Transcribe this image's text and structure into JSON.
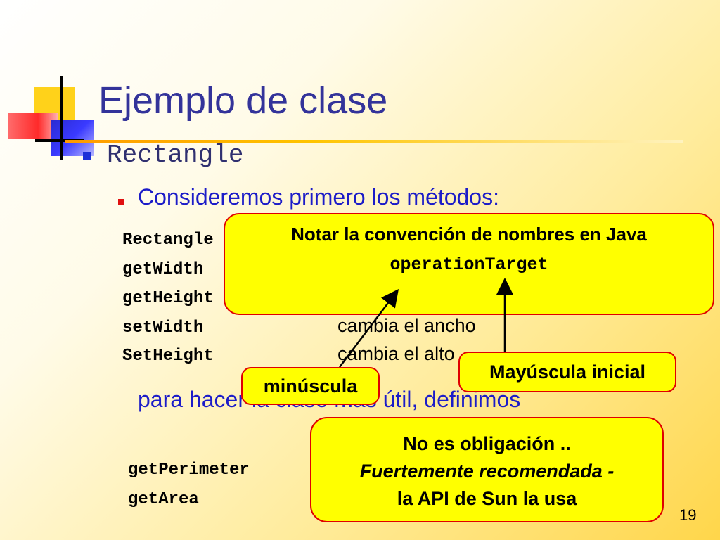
{
  "slide": {
    "title": "Ejemplo de clase",
    "bullet1": "Rectangle",
    "bullet2": "Consideremos primero los métodos:",
    "methods": [
      {
        "name": "Rectangle",
        "desc": ""
      },
      {
        "name": "getWidth",
        "desc": ""
      },
      {
        "name": "getHeight",
        "desc": ""
      },
      {
        "name": "setWidth",
        "desc": "cambia el ancho"
      },
      {
        "name": "SetHeight",
        "desc": "cambia el alto"
      }
    ],
    "paragraph": "para hacer la clase más útil, definimos",
    "extra_methods": [
      "getPerimeter",
      "getArea"
    ],
    "page_number": "19"
  },
  "callouts": {
    "naming": {
      "line1": "Notar la convención de nombres en Java",
      "line2": "operationTarget"
    },
    "lowercase": "minúscula",
    "uppercase": "Mayúscula inicial",
    "recommendation": {
      "line1": "No es obligación ..",
      "line2": "Fuertemente recomendada -",
      "line3": "la API de Sun la usa"
    }
  },
  "colors": {
    "callout_fill": "#ffff00",
    "callout_border": "#e00000",
    "title": "#33339a",
    "bullet_text": "#1c1cc8"
  }
}
